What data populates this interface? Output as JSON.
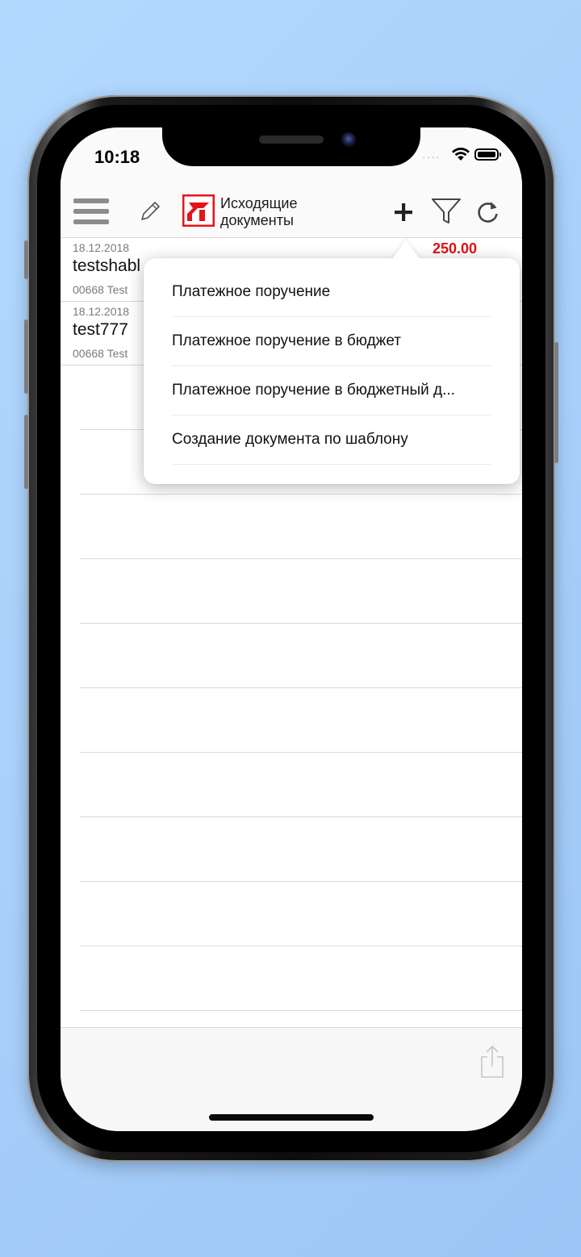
{
  "status_bar": {
    "time": "10:18",
    "signal_dots": "····"
  },
  "nav": {
    "title_line1": "Исходящие",
    "title_line2": "документы",
    "icons": [
      "menu-icon",
      "pencil-icon",
      "logo",
      "plus-icon",
      "filter-icon",
      "refresh-icon"
    ]
  },
  "documents": [
    {
      "date": "18.12.2018",
      "name": "testshabl",
      "meta": "00668 Test",
      "amount": "250.00"
    },
    {
      "date": "18.12.2018",
      "name": "test777",
      "meta": "00668 Test",
      "amount": ""
    }
  ],
  "popover": {
    "items": [
      {
        "label": "Платежное поручение"
      },
      {
        "label": "Платежное поручение в бюджет"
      },
      {
        "label": "Платежное поручение в бюджетный д..."
      },
      {
        "label": "Создание документа по шаблону"
      }
    ]
  },
  "bottom_bar": {
    "icons": [
      "share-icon"
    ]
  },
  "colors": {
    "background": "#a6cdf9",
    "amount": "#e01010",
    "logo_red": "#e3151c"
  }
}
